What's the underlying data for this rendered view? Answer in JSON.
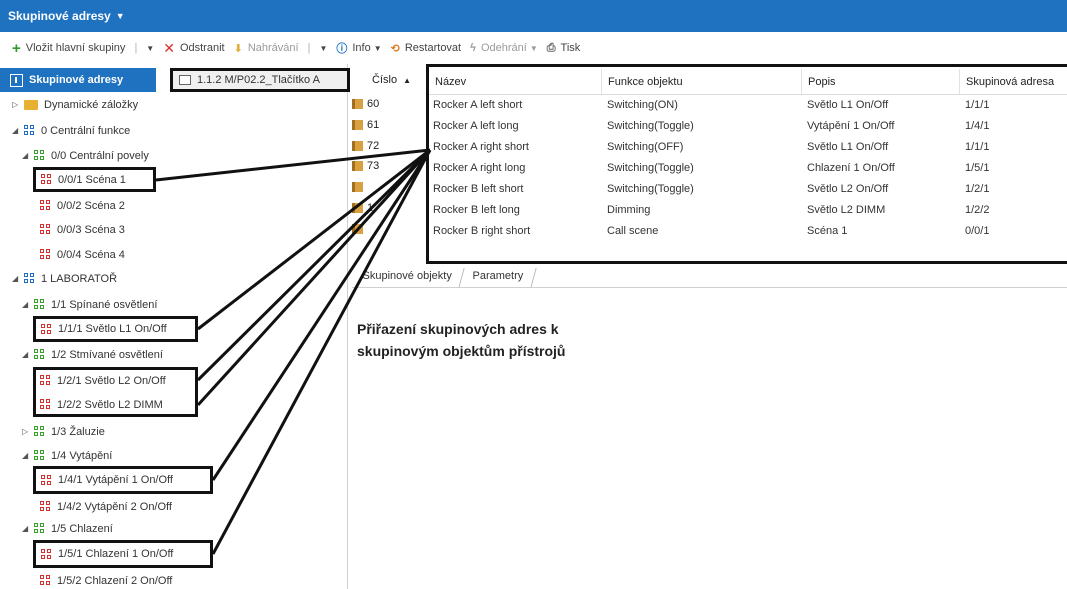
{
  "title": "Skupinové adresy",
  "toolbar": {
    "insert": "Vložit hlavní skupiny",
    "remove": "Odstranit",
    "download": "Nahrávání",
    "info": "Info",
    "reset": "Restartovat",
    "unload": "Odehrání",
    "print": "Tisk"
  },
  "left_tab": "Skupinové adresy",
  "device_tab": "1.1.2 M/P02.2_Tlačítko A",
  "tree": [
    {
      "label": "Dynamické záložky"
    },
    {
      "label": "0 Centrální funkce"
    },
    {
      "label": "0/0 Centrální povely"
    },
    {
      "label": "0/0/1 Scéna 1"
    },
    {
      "label": "0/0/2 Scéna 2"
    },
    {
      "label": "0/0/3 Scéna 3"
    },
    {
      "label": "0/0/4 Scéna 4"
    },
    {
      "label": "1 LABORATOŘ"
    },
    {
      "label": "1/1 Spínané osvětlení"
    },
    {
      "label": "1/1/1 Světlo L1 On/Off"
    },
    {
      "label": "1/2 Stmívané osvětlení"
    },
    {
      "label": "1/2/1 Světlo L2 On/Off"
    },
    {
      "label": "1/2/2 Světlo L2 DIMM"
    },
    {
      "label": "1/3 Žaluzie"
    },
    {
      "label": "1/4 Vytápění"
    },
    {
      "label": "1/4/1 Vytápění 1 On/Off"
    },
    {
      "label": "1/4/2 Vytápění 2 On/Off"
    },
    {
      "label": "1/5 Chlazení"
    },
    {
      "label": "1/5/1 Chlazení 1 On/Off"
    },
    {
      "label": "1/5/2 Chlazení 2 On/Off"
    }
  ],
  "numbers": {
    "header": "Číslo",
    "sort_icon": "sort-asc-icon",
    "rows": [
      "60",
      "61",
      "72",
      "73",
      "",
      "1",
      ""
    ]
  },
  "table": {
    "headers": [
      "Název",
      "Funkce objektu",
      "Popis",
      "Skupinová adresa"
    ],
    "rows": [
      [
        "Rocker A left short",
        "Switching(ON)",
        "Světlo L1 On/Off",
        "1/1/1"
      ],
      [
        "Rocker A left long",
        "Switching(Toggle)",
        "Vytápění 1 On/Off",
        "1/4/1"
      ],
      [
        "Rocker A right short",
        "Switching(OFF)",
        "Světlo L1 On/Off",
        "1/1/1"
      ],
      [
        "Rocker A right long",
        "Switching(Toggle)",
        "Chlazení 1 On/Off",
        "1/5/1"
      ],
      [
        "Rocker B left short",
        "Switching(Toggle)",
        "Světlo L2 On/Off",
        "1/2/1"
      ],
      [
        "Rocker B left long",
        "Dimming",
        "Světlo L2 DIMM",
        "1/2/2"
      ],
      [
        "Rocker B right short",
        "Call scene",
        "Scéna 1",
        "0/0/1"
      ]
    ]
  },
  "bottom_tabs": [
    "Skupinové objekty",
    "Parametry"
  ],
  "annotation": "Přiřazení skupinových adres k skupinovým objektům přístrojů",
  "colors": {
    "accent": "#1f72c0",
    "highlight": "#111111"
  }
}
